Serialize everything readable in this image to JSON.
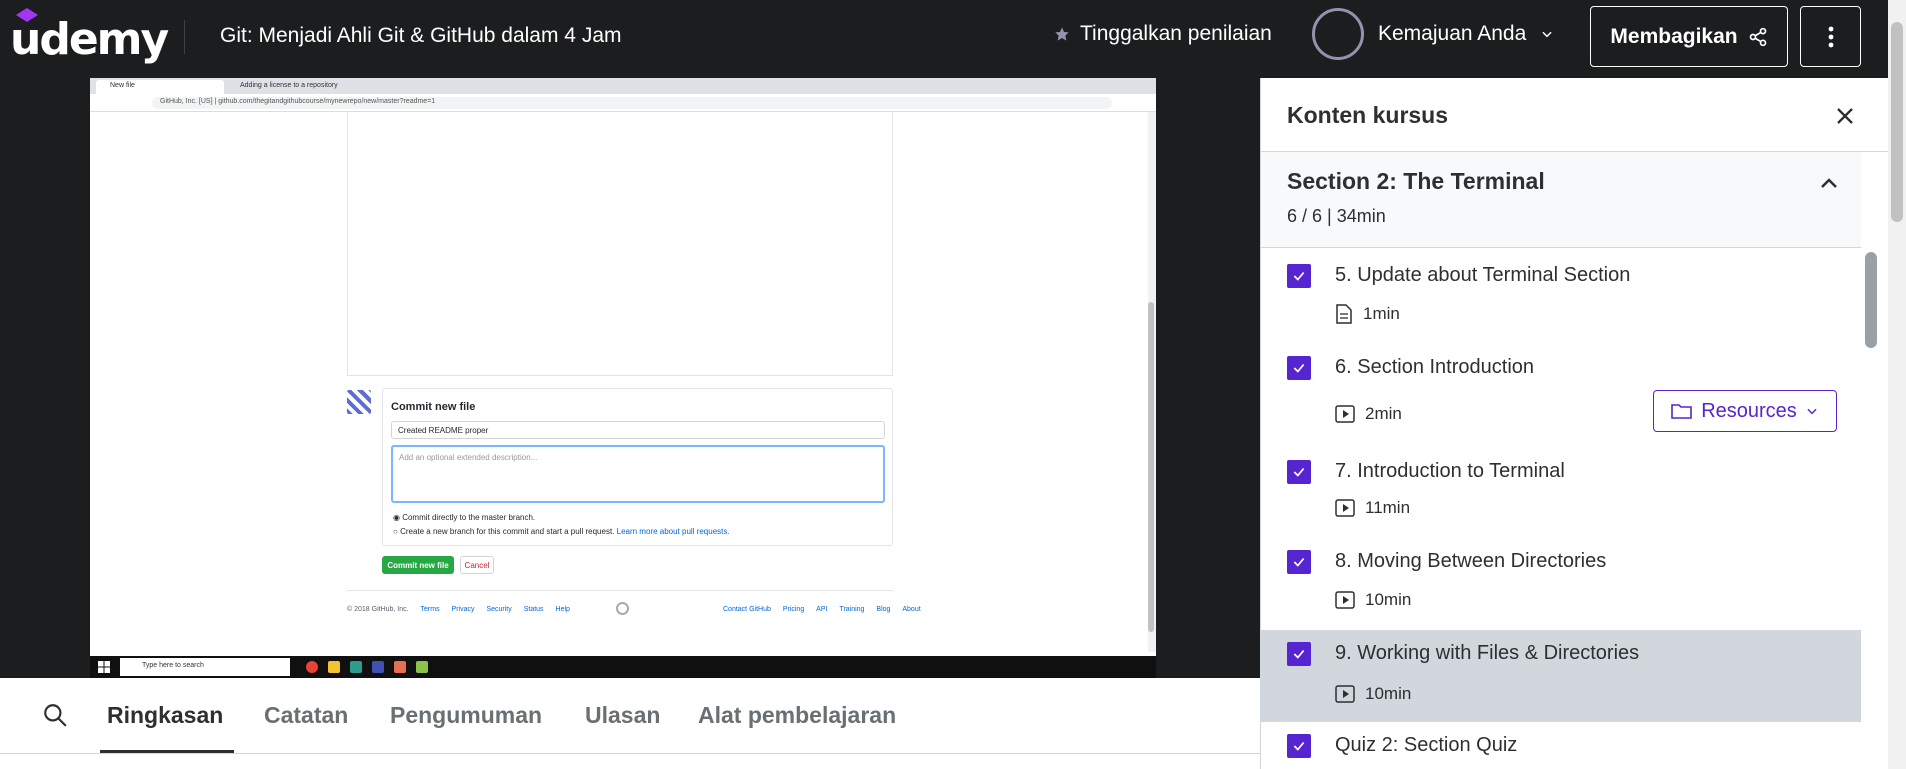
{
  "header": {
    "logo_text": "udemy",
    "course_title": "Git: Menjadi Ahli Git & GitHub dalam 4 Jam",
    "rate_label": "Tinggalkan penilaian",
    "progress_label": "Kemajuan Anda",
    "share_label": "Membagikan"
  },
  "video": {
    "browser_tabs": [
      "New file",
      "Adding a license to a repository"
    ],
    "url_site": "GitHub, Inc. [US]",
    "url": "github.com/thegitandgithubcourse/mynewrepo/new/master?readme=1",
    "commit_title": "Commit new file",
    "commit_message": "Created README proper",
    "commit_desc_placeholder": "Add an optional extended description...",
    "radio_direct": "Commit directly to the master branch.",
    "radio_branch": "Create a new branch for this commit and start a pull request.",
    "radio_branch_link": "Learn more about pull requests.",
    "btn_commit": "Commit new file",
    "btn_cancel": "Cancel",
    "footer_copyright": "© 2018 GitHub, Inc.",
    "footer_left_links": [
      "Terms",
      "Privacy",
      "Security",
      "Status",
      "Help"
    ],
    "footer_right_links": [
      "Contact GitHub",
      "Pricing",
      "API",
      "Training",
      "Blog",
      "About"
    ],
    "taskbar_search": "Type here to search"
  },
  "tabs": {
    "items": [
      "Ringkasan",
      "Catatan",
      "Pengumuman",
      "Ulasan",
      "Alat pembelajaran"
    ],
    "active": "Ringkasan"
  },
  "sidebar": {
    "title": "Konten kursus",
    "section_title": "Section 2: The Terminal",
    "section_meta": "6 / 6 | 34min",
    "lectures": [
      {
        "title": "5. Update about Terminal Section",
        "duration": "1min",
        "icon": "document-icon",
        "checked": true
      },
      {
        "title": "6. Section Introduction",
        "duration": "2min",
        "icon": "video-icon",
        "checked": true,
        "resources": "Resources"
      },
      {
        "title": "7. Introduction to Terminal",
        "duration": "11min",
        "icon": "video-icon",
        "checked": true
      },
      {
        "title": "8. Moving Between Directories",
        "duration": "10min",
        "icon": "video-icon",
        "checked": true
      },
      {
        "title": "9. Working with Files & Directories",
        "duration": "10min",
        "icon": "video-icon",
        "checked": true,
        "active": true
      },
      {
        "title": "Quiz 2: Section Quiz",
        "checked": true
      }
    ]
  },
  "colors": {
    "header_bg": "#1c1d1f",
    "accent_purple": "#5624d0",
    "active_row_bg": "#d1d7dc",
    "github_green": "#28a745"
  }
}
